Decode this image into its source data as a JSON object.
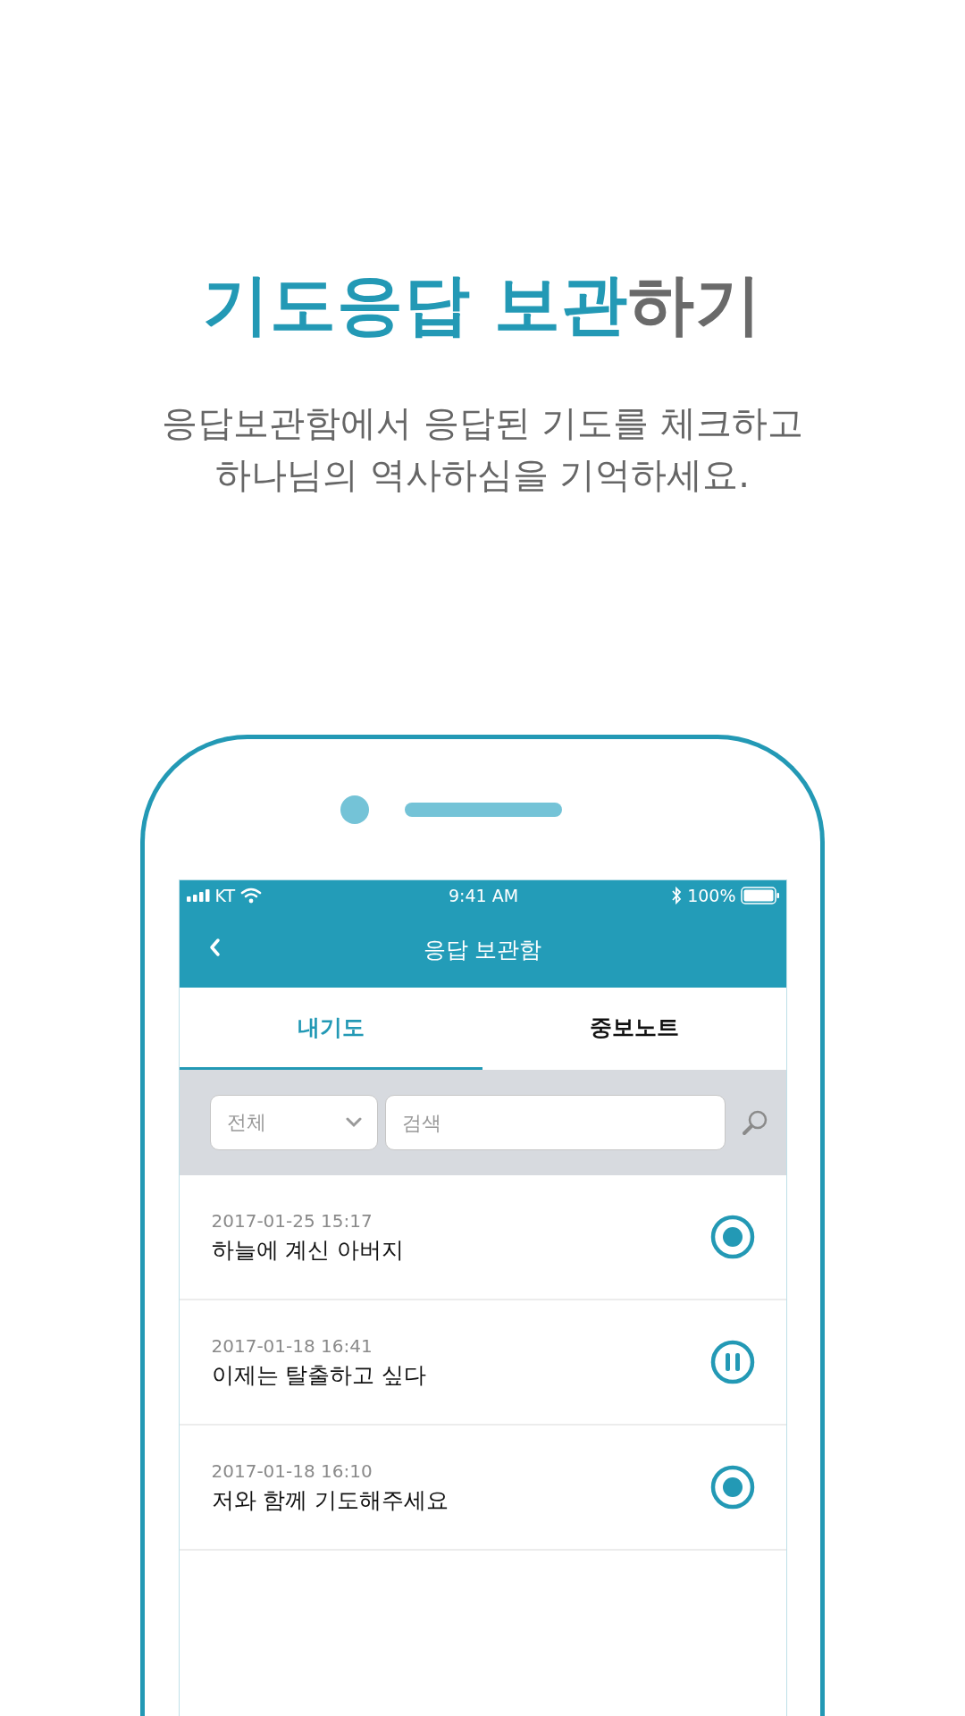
{
  "headline": {
    "accent": "기도응답 보관",
    "rest": "하기"
  },
  "subtitle": "응답보관함에서 응답된 기도를 체크하고\n하나님의 역사하심을 기억하세요.",
  "status_bar": {
    "carrier": "KT",
    "time": "9:41 AM",
    "battery": "100%"
  },
  "nav": {
    "title": "응답 보관함"
  },
  "tabs": [
    {
      "label": "내기도",
      "selected": true
    },
    {
      "label": "중보노트",
      "selected": false
    }
  ],
  "filter": {
    "category": "전체",
    "search_placeholder": "검색"
  },
  "rows": [
    {
      "date": "2017-01-25 15:17",
      "title": "하늘에 계신 아버지",
      "kind": "answered"
    },
    {
      "date": "2017-01-18 16:41",
      "title": "이제는 탈출하고 싶다",
      "kind": "paused"
    },
    {
      "date": "2017-01-18 16:10",
      "title": "저와 함께 기도해주세요",
      "kind": "answered"
    }
  ]
}
